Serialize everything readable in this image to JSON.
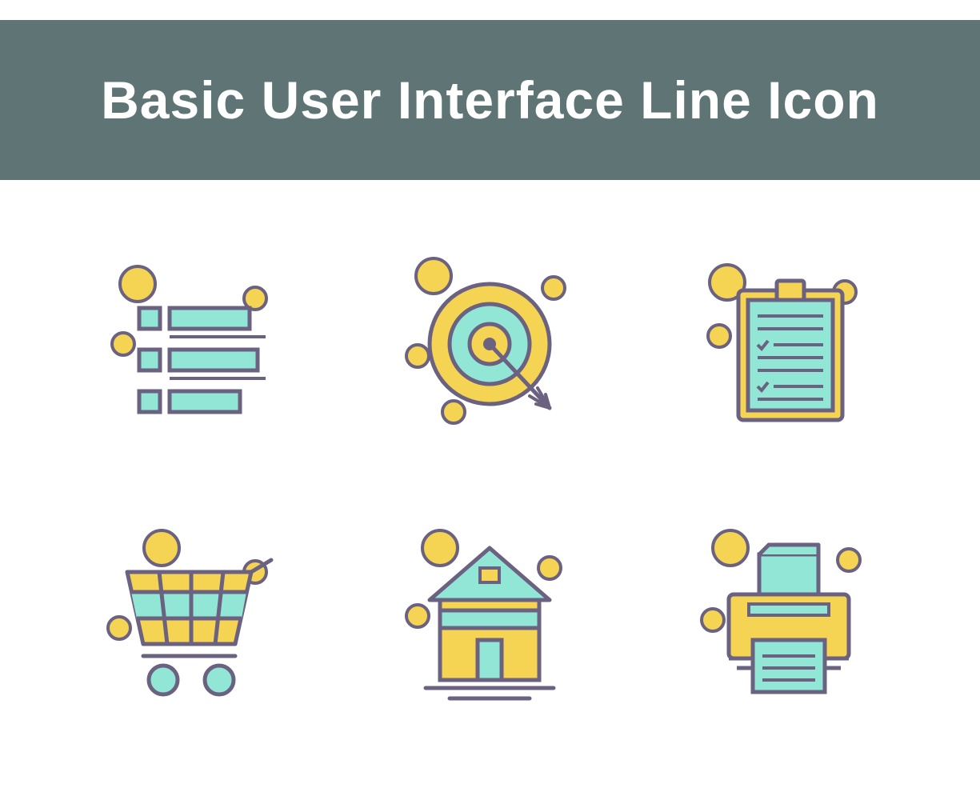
{
  "header": {
    "title": "Basic User Interface Line Icon"
  },
  "colors": {
    "banner": "#5f7575",
    "stroke": "#6b6180",
    "yellow": "#f4d452",
    "teal": "#92e6d6",
    "white": "#ffffff"
  },
  "icons": [
    {
      "name": "list-icon",
      "semantic": "list"
    },
    {
      "name": "target-icon",
      "semantic": "target"
    },
    {
      "name": "clipboard-icon",
      "semantic": "clipboard-checklist"
    },
    {
      "name": "shopping-cart-icon",
      "semantic": "shopping-cart"
    },
    {
      "name": "home-icon",
      "semantic": "home"
    },
    {
      "name": "printer-icon",
      "semantic": "printer"
    }
  ]
}
